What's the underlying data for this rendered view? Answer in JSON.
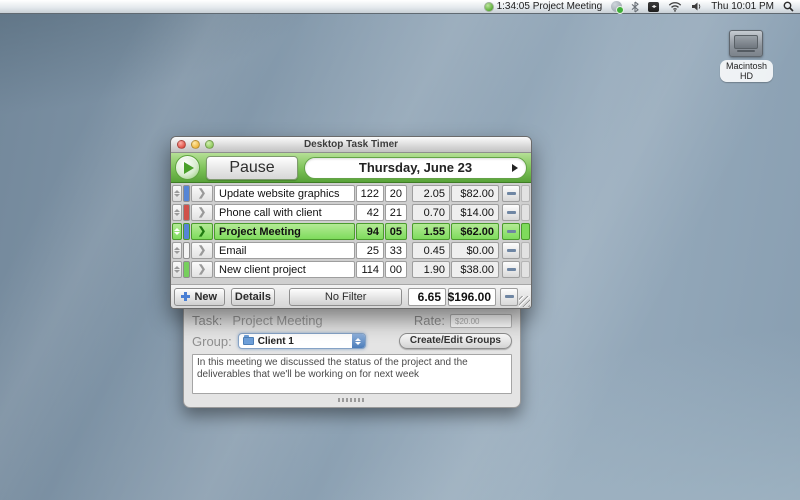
{
  "menu_bar": {
    "timer_status": "1:34:05 Project Meeting",
    "clock": "Thu 10:01 PM"
  },
  "desktop": {
    "hd_label": "Macintosh HD"
  },
  "window": {
    "title": "Desktop Task Timer",
    "toolbar": {
      "pause_label": "Pause",
      "date_label": "Thursday, June 23"
    },
    "tasks": [
      {
        "name": "Update website graphics",
        "min": "122",
        "sec": "20",
        "hours": "2.05",
        "amount": "$82.00",
        "color": "#5585d6",
        "selected": false
      },
      {
        "name": "Phone call with client",
        "min": "42",
        "sec": "21",
        "hours": "0.70",
        "amount": "$14.00",
        "color": "#d0514a",
        "selected": false
      },
      {
        "name": "Project Meeting",
        "min": "94",
        "sec": "05",
        "hours": "1.55",
        "amount": "$62.00",
        "color": "#5585d6",
        "selected": true
      },
      {
        "name": "Email",
        "min": "25",
        "sec": "33",
        "hours": "0.45",
        "amount": "$0.00",
        "color": "#f4f4f4",
        "selected": false
      },
      {
        "name": "New client project",
        "min": "114",
        "sec": "00",
        "hours": "1.90",
        "amount": "$38.00",
        "color": "#77cf5d",
        "selected": false
      }
    ],
    "footer": {
      "new_label": "New",
      "details_label": "Details",
      "filter_label": "No Filter",
      "total_hours": "6.65",
      "total_amount": "$196.00"
    }
  },
  "drawer": {
    "task_label": "Task:",
    "task_value": "Project Meeting",
    "rate_label": "Rate:",
    "rate_value": "$20.00",
    "group_label": "Group:",
    "group_value": "Client 1",
    "groups_button": "Create/Edit Groups",
    "notes": "In this meeting we discussed the status of the project and the deliverables that we'll be working on for next week"
  },
  "colors": {
    "accent_green": "#7cc157",
    "selection_green": "#7edb5c",
    "minus_dash": "#6f86a3"
  }
}
